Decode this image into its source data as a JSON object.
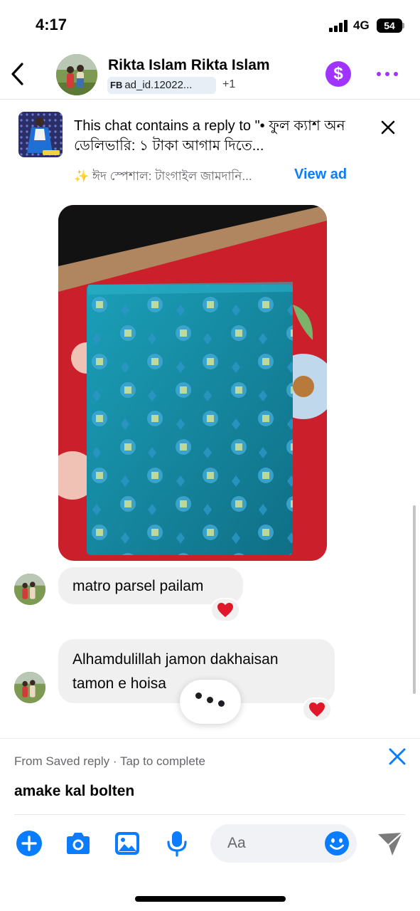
{
  "status_bar": {
    "time": "4:17",
    "network": "4G",
    "battery": "54"
  },
  "header": {
    "contact_name": "Rikta Islam Rikta Islam",
    "ad_tag": "FB",
    "ad_id": "ad_id.12022...",
    "extra_count": "+1",
    "accent_color": "#a033ff"
  },
  "ad_banner": {
    "reply_text": "This chat contains a reply to \"• ফুল ক্যাশ অন ডেলিভারি: ১ টাকা আগাম দিতে...",
    "subtitle": "✨ ঈদ স্পেশাল: টাংগাইল জামদানি...",
    "view_ad_label": "View ad"
  },
  "messages": [
    {
      "type": "photo",
      "description_icon": "saree-photo"
    },
    {
      "type": "text",
      "text": "matro parsel pailam",
      "reaction": "heart"
    },
    {
      "type": "text",
      "text": "Alhamdulillah jamon dakhaisan tamon e hoisa",
      "reaction": "heart"
    }
  ],
  "saved_reply": {
    "hint": "From Saved reply · Tap to complete",
    "text": "amake kal bolten"
  },
  "composer": {
    "placeholder": "Aa",
    "accent_color": "#0a7cff"
  }
}
